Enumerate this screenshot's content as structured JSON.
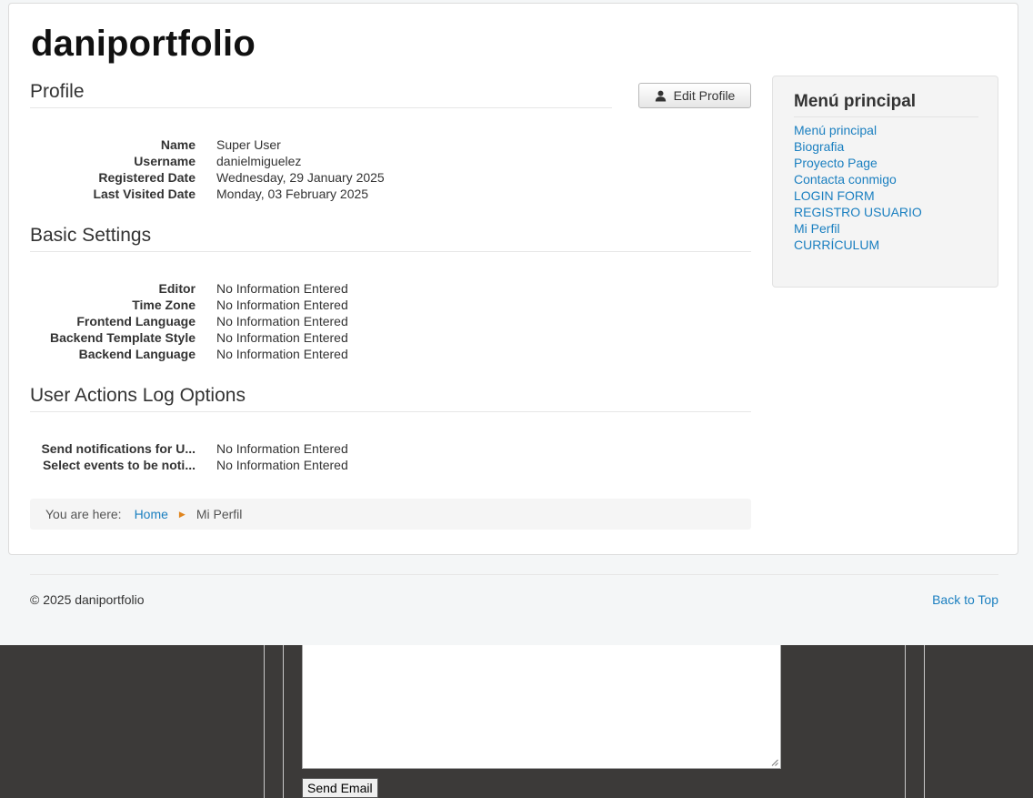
{
  "site": {
    "title": "daniportfolio"
  },
  "profile": {
    "heading": "Profile",
    "edit_button": "Edit Profile",
    "fields": [
      {
        "label": "Name",
        "value": "Super User"
      },
      {
        "label": "Username",
        "value": "danielmiguelez"
      },
      {
        "label": "Registered Date",
        "value": "Wednesday, 29 January 2025"
      },
      {
        "label": "Last Visited Date",
        "value": "Monday, 03 February 2025"
      }
    ]
  },
  "basic_settings": {
    "heading": "Basic Settings",
    "fields": [
      {
        "label": "Editor",
        "value": "No Information Entered"
      },
      {
        "label": "Time Zone",
        "value": "No Information Entered"
      },
      {
        "label": "Frontend Language",
        "value": "No Information Entered"
      },
      {
        "label": "Backend Template Style",
        "value": "No Information Entered"
      },
      {
        "label": "Backend Language",
        "value": "No Information Entered"
      }
    ]
  },
  "user_actions": {
    "heading": "User Actions Log Options",
    "fields": [
      {
        "label": "Send notifications for U...",
        "value": "No Information Entered"
      },
      {
        "label": "Select events to be noti...",
        "value": "No Information Entered"
      }
    ]
  },
  "breadcrumb": {
    "label": "You are here:",
    "home": "Home",
    "current": "Mi Perfil"
  },
  "sidebar": {
    "title": "Menú principal",
    "items": [
      "Menú principal",
      "Biografia",
      "Proyecto Page",
      "Contacta conmigo",
      "LOGIN FORM",
      "REGISTRO USUARIO",
      "Mi Perfil",
      "CURRÍCULUM"
    ]
  },
  "footer": {
    "copyright": "© 2025 daniportfolio",
    "back_to_top": "Back to Top"
  },
  "contact_form": {
    "send_button": "Send Email"
  },
  "colors": {
    "link": "#1a7fc0",
    "breadcrumb_separator": "#e0851e",
    "dark_background": "#3c3a39"
  }
}
